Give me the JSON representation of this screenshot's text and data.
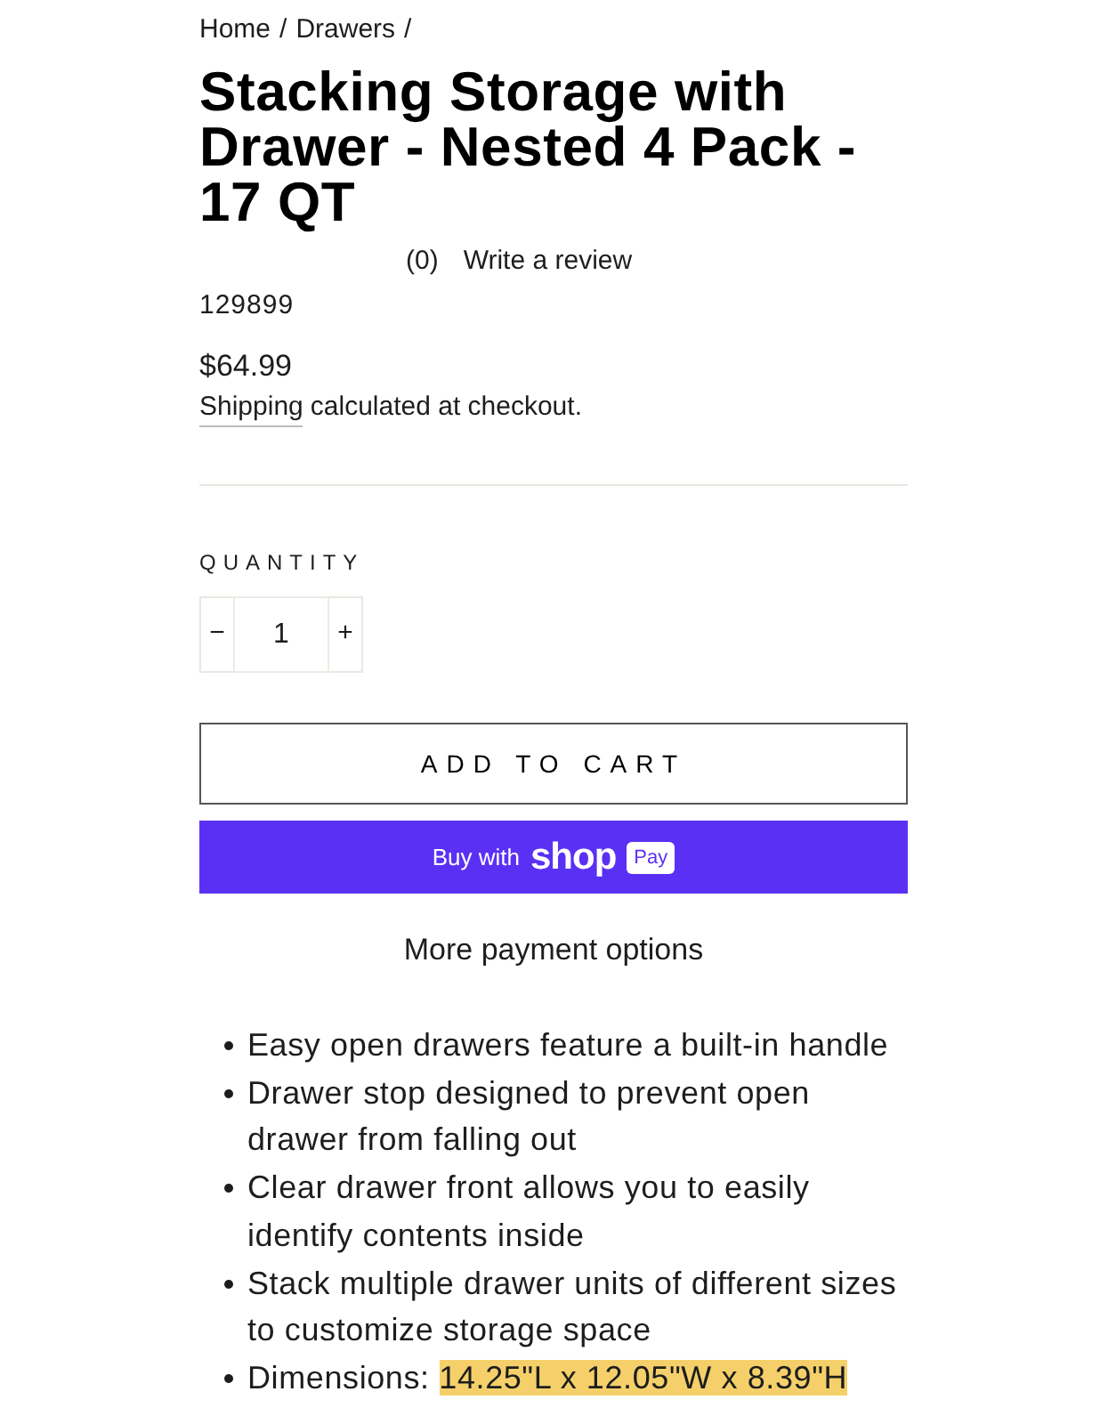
{
  "breadcrumb": [
    {
      "label": "Home"
    },
    {
      "label": "Drawers"
    }
  ],
  "breadcrumb_separator": "/",
  "title": "Stacking Storage with Drawer - Nested 4 Pack - 17 QT",
  "reviews": {
    "count": "(0)",
    "link": "Write a review"
  },
  "sku": "129899",
  "price": "$64.99",
  "shipping": {
    "link": "Shipping",
    "text": "calculated at checkout."
  },
  "quantity": {
    "label": "QUANTITY",
    "decrement": "−",
    "value": "1",
    "increment": "+"
  },
  "add_to_cart": "ADD TO CART",
  "shop_pay_button": {
    "prefix": "Buy with",
    "brand": "shop",
    "badge": "Pay"
  },
  "more_payment_options": "More payment options",
  "features": [
    {
      "text": "Easy open drawers feature a built-in handle"
    },
    {
      "text": "Drawer stop designed to prevent open drawer from falling out"
    },
    {
      "text": "Clear drawer front allows you to easily identify contents inside"
    },
    {
      "text": "Stack multiple drawer units of different sizes to customize storage space"
    },
    {
      "text": "Dimensions: ",
      "highlight": "14.25\"L x 12.05\"W x 8.39\"H"
    }
  ]
}
